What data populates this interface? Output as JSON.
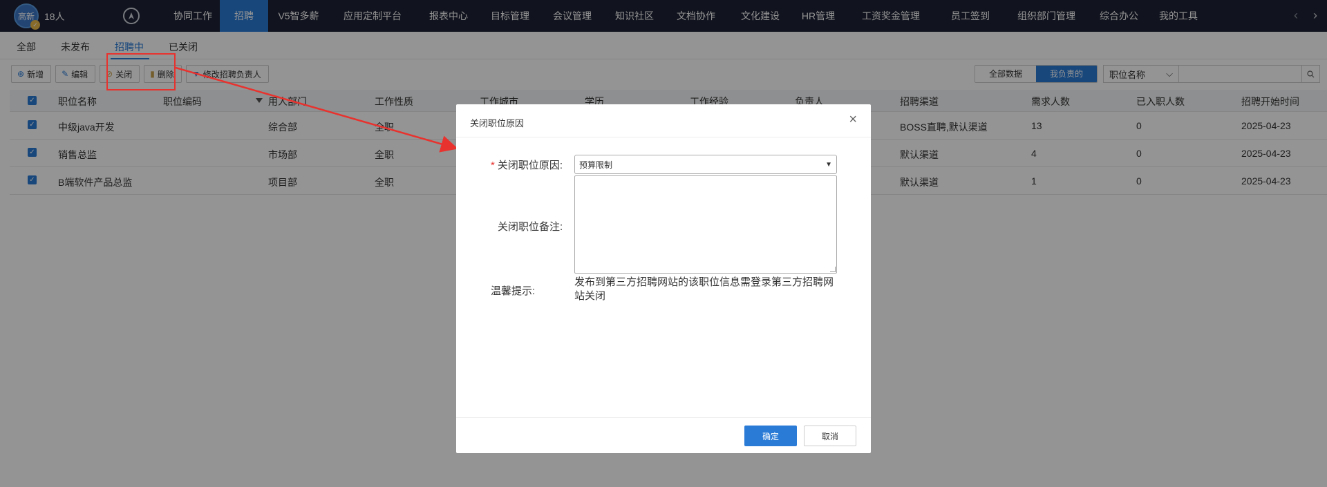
{
  "user": {
    "avatar_text": "高新",
    "count": "18人"
  },
  "nav": {
    "items": [
      "协同工作",
      "招聘",
      "V5智多薪",
      "应用定制平台",
      "报表中心",
      "目标管理",
      "会议管理",
      "知识社区",
      "文档协作",
      "文化建设",
      "HR管理",
      "工资奖金管理",
      "员工签到",
      "组织部门管理",
      "综合办公",
      "我的工具"
    ],
    "active_index": 1,
    "prev_arrow": "‹",
    "next_arrow": "›"
  },
  "subtabs": {
    "items": [
      "全部",
      "未发布",
      "招聘中",
      "已关闭"
    ],
    "active_index": 2
  },
  "toolbar": {
    "add_label": "新增",
    "edit_label": "编辑",
    "close_label": "关闭",
    "delete_label": "删除",
    "change_owner_label": "修改招聘负责人"
  },
  "filters": {
    "all_data_label": "全部数据",
    "mine_label": "我负责的",
    "field_select_value": "职位名称",
    "search_placeholder": ""
  },
  "table": {
    "headers": [
      "职位名称",
      "职位编码",
      "用人部门",
      "工作性质",
      "工作城市",
      "学历",
      "工作经验",
      "负责人",
      "招聘渠道",
      "需求人数",
      "已入职人数",
      "招聘开始时间"
    ],
    "rows": [
      [
        "中级java开发",
        "",
        "综合部",
        "全职",
        "",
        "",
        "",
        "",
        "BOSS直聘,默认渠道",
        "13",
        "0",
        "2025-04-23"
      ],
      [
        "销售总监",
        "",
        "市场部",
        "全职",
        "",
        "",
        "",
        "",
        "默认渠道",
        "4",
        "0",
        "2025-04-23"
      ],
      [
        "B端软件产品总监",
        "",
        "项目部",
        "全职",
        "",
        "",
        "",
        "",
        "默认渠道",
        "1",
        "0",
        "2025-04-23"
      ]
    ]
  },
  "dialog": {
    "title": "关闭职位原因",
    "reason_label": "关闭职位原因:",
    "reason_value": "预算限制",
    "remark_label": "关闭职位备注:",
    "remark_value": "",
    "tip_label": "温馨提示:",
    "tip_text": "发布到第三方招聘网站的该职位信息需登录第三方招聘网站关闭",
    "ok_label": "确定",
    "cancel_label": "取消"
  },
  "colors": {
    "nav_bg": "#1e2235",
    "accent": "#2a7bd6",
    "annotation": "#e8322e"
  }
}
